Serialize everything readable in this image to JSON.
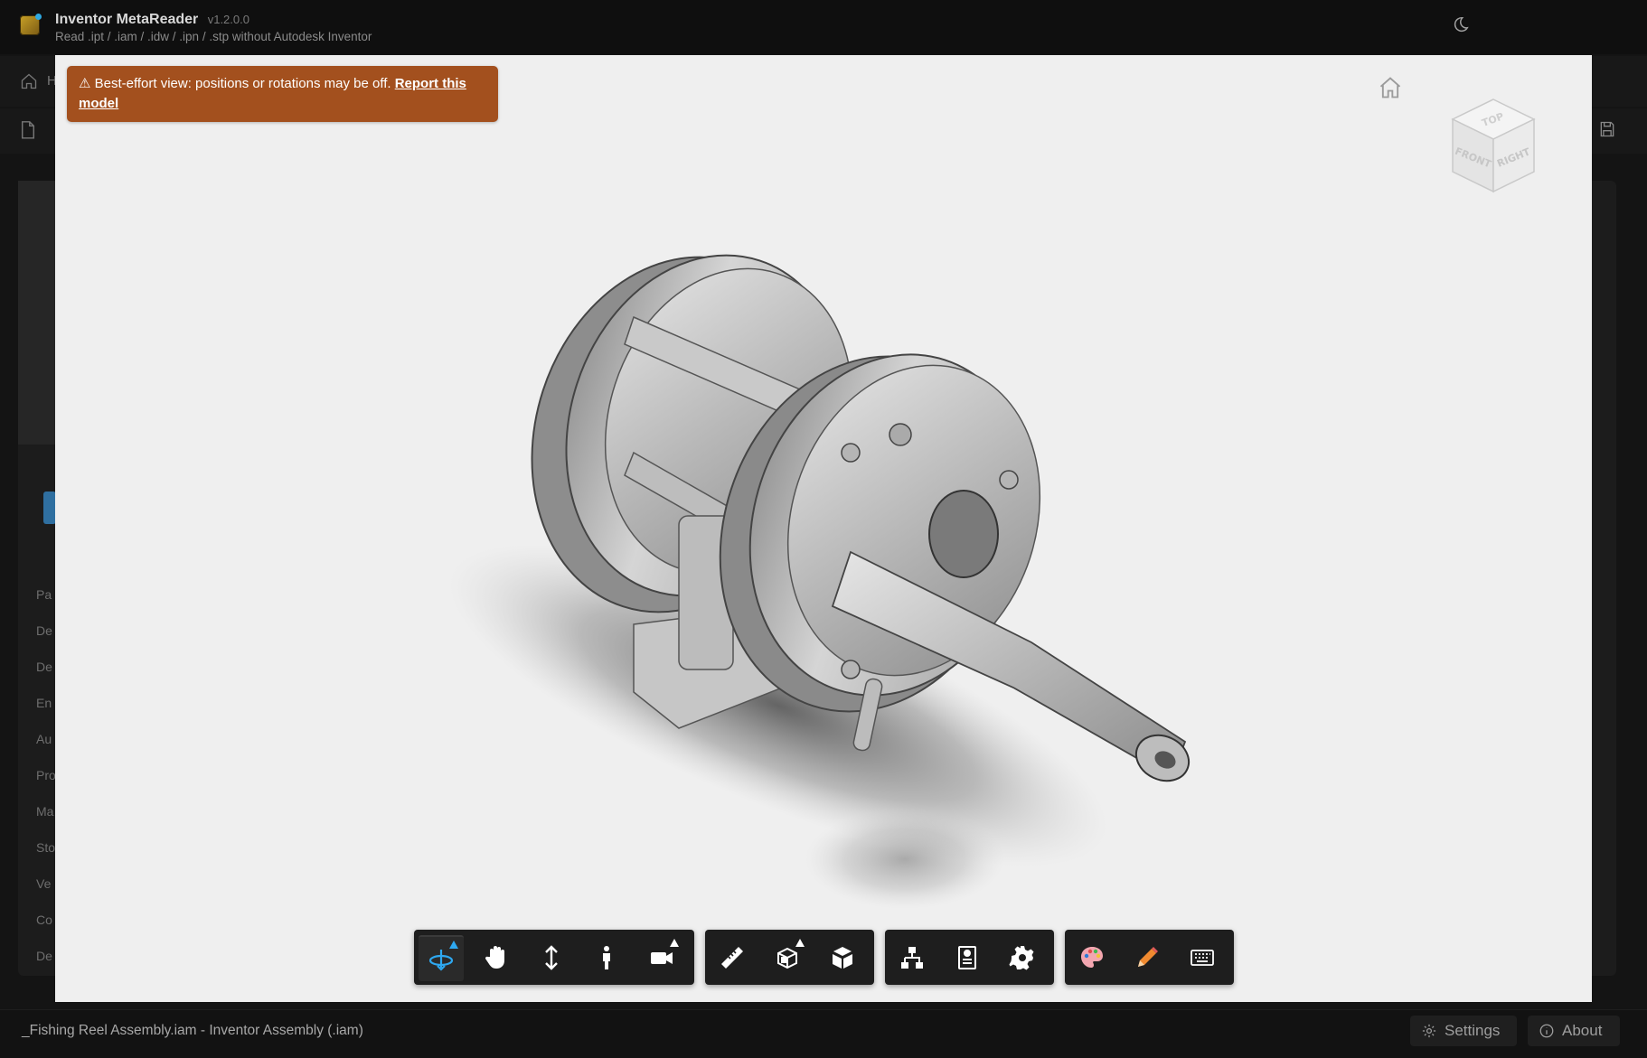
{
  "app": {
    "title": "Inventor MetaReader",
    "version": "v1.2.0.0",
    "subtitle": "Read .ipt / .iam / .idw / .ipn / .stp without Autodesk Inventor"
  },
  "background": {
    "nav_home_label": "H",
    "side_items": [
      "Pa",
      "De",
      "De",
      "En",
      "Au",
      "Pro",
      "Ma",
      "Sto",
      "Ve",
      "Co",
      "De"
    ]
  },
  "viewer": {
    "warning_text": "⚠ Best-effort view: positions or rotations may be off. ",
    "warning_link": "Report this model",
    "viewcube": {
      "top": "TOP",
      "front": "FRONT",
      "right": "RIGHT"
    }
  },
  "toolbar": {
    "groups": [
      [
        "orbit-icon",
        "pan-icon",
        "zoom-icon",
        "walk-icon",
        "camera-icon"
      ],
      [
        "measure-icon",
        "section-icon",
        "explode-icon"
      ],
      [
        "model-browser-icon",
        "properties-icon",
        "settings-icon"
      ],
      [
        "palette-icon",
        "markup-pencil-icon",
        "keyboard-icon"
      ]
    ],
    "active_tool": "orbit-icon",
    "accent_color": "#2ea8f0"
  },
  "status": {
    "file": "_Fishing Reel Assembly.iam - Inventor Assembly (.iam)",
    "settings_label": "Settings",
    "about_label": "About"
  },
  "colors": {
    "warning_bg": "#a3501e",
    "viewer_bg": "#efefef",
    "palette_icon": "#f3a6b0",
    "pencil_icon": "#f08a30"
  }
}
